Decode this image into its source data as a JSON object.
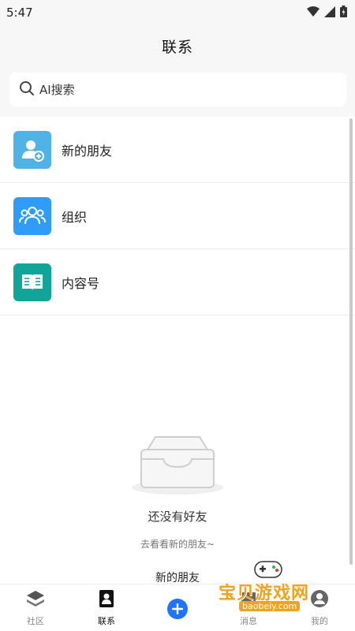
{
  "status_bar": {
    "time": "5:47"
  },
  "header": {
    "title": "联系"
  },
  "search": {
    "placeholder": "AI搜索"
  },
  "list": {
    "items": [
      {
        "label": "新的朋友",
        "icon": "person-add-icon",
        "color": "#4fb3e6"
      },
      {
        "label": "组织",
        "icon": "group-icon",
        "color": "#2f9cf7"
      },
      {
        "label": "内容号",
        "icon": "book-icon",
        "color": "#11a59a"
      }
    ]
  },
  "empty_state": {
    "icon": "empty-inbox-icon",
    "title": "还没有好友",
    "subtitle": "去看看新的朋友~",
    "link": "新的朋友"
  },
  "tabbar": {
    "tabs": [
      {
        "label": "社区",
        "icon": "layers-icon",
        "active": false
      },
      {
        "label": "联系",
        "icon": "contacts-icon",
        "active": true
      },
      {
        "label": "",
        "icon": "plus-icon",
        "active": false
      },
      {
        "label": "消息",
        "icon": "message-icon",
        "active": false
      },
      {
        "label": "我的",
        "icon": "profile-icon",
        "active": false
      }
    ]
  },
  "watermark": {
    "text": "宝贝游戏网",
    "url": "baobeiy.com"
  },
  "colors": {
    "accent": "#1e73ff",
    "background": "#f7f7f7"
  }
}
